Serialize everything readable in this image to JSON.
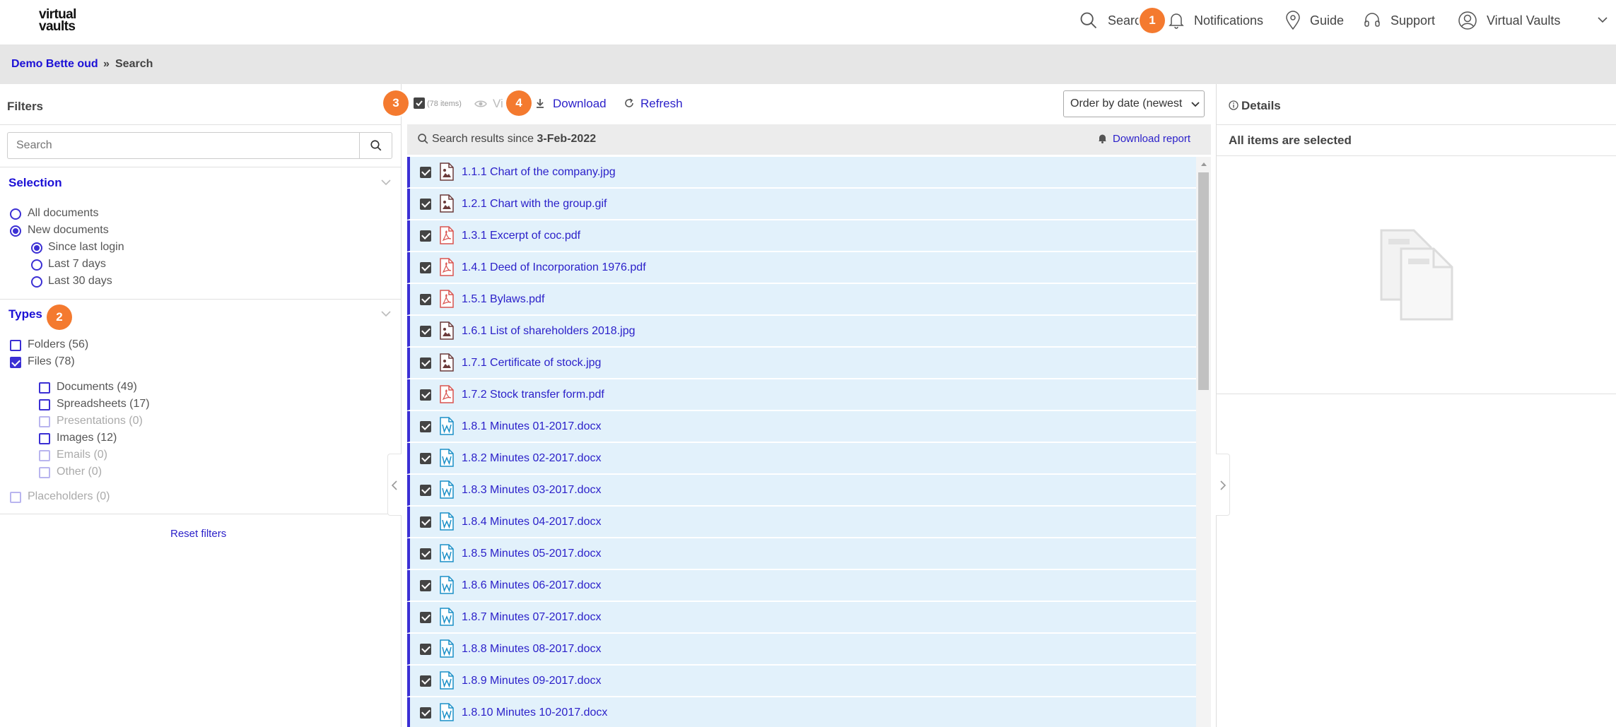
{
  "app": {
    "logo_line1": "virtual",
    "logo_line2": "vaults"
  },
  "topnav": {
    "search": "Searc",
    "notifications": "Notifications",
    "guide": "Guide",
    "support": "Support",
    "account": "Virtual Vaults"
  },
  "badges": {
    "b1": "1",
    "b2": "2",
    "b3": "3",
    "b4": "4"
  },
  "breadcrumb": {
    "root": "Demo Bette oud",
    "sep": "»",
    "current": "Search"
  },
  "filters": {
    "title": "Filters",
    "search_placeholder": "Search",
    "selection": {
      "title": "Selection",
      "all": "All documents",
      "new": "New documents",
      "since_login": "Since last login",
      "last7": "Last 7 days",
      "last30": "Last 30 days"
    },
    "types": {
      "title": "Types",
      "folders": "Folders (56)",
      "files": "Files (78)",
      "documents": "Documents (49)",
      "spreadsheets": "Spreadsheets (17)",
      "presentations": "Presentations (0)",
      "images": "Images (12)",
      "emails": "Emails (0)",
      "other": "Other (0)",
      "placeholders": "Placeholders (0)"
    },
    "reset": "Reset filters"
  },
  "toolbar": {
    "item_count": "(78 items)",
    "view": "Vi",
    "download": "Download",
    "refresh": "Refresh",
    "order": "Order by date (newest"
  },
  "results": {
    "prefix": "Search results since",
    "date": "3-Feb-2022",
    "download_report": "Download report",
    "items": [
      {
        "name": "1.1.1 Chart of the company.jpg",
        "type": "image"
      },
      {
        "name": "1.2.1 Chart with the group.gif",
        "type": "image"
      },
      {
        "name": "1.3.1 Excerpt of coc.pdf",
        "type": "pdf"
      },
      {
        "name": "1.4.1 Deed of Incorporation 1976.pdf",
        "type": "pdf"
      },
      {
        "name": "1.5.1 Bylaws.pdf",
        "type": "pdf"
      },
      {
        "name": "1.6.1 List of shareholders 2018.jpg",
        "type": "image"
      },
      {
        "name": "1.7.1 Certificate of stock.jpg",
        "type": "image"
      },
      {
        "name": "1.7.2 Stock transfer form.pdf",
        "type": "pdf"
      },
      {
        "name": "1.8.1 Minutes 01-2017.docx",
        "type": "word"
      },
      {
        "name": "1.8.2 Minutes 02-2017.docx",
        "type": "word"
      },
      {
        "name": "1.8.3 Minutes 03-2017.docx",
        "type": "word"
      },
      {
        "name": "1.8.4 Minutes 04-2017.docx",
        "type": "word"
      },
      {
        "name": "1.8.5 Minutes 05-2017.docx",
        "type": "word"
      },
      {
        "name": "1.8.6 Minutes 06-2017.docx",
        "type": "word"
      },
      {
        "name": "1.8.7 Minutes 07-2017.docx",
        "type": "word"
      },
      {
        "name": "1.8.8 Minutes 08-2017.docx",
        "type": "word"
      },
      {
        "name": "1.8.9 Minutes 09-2017.docx",
        "type": "word"
      },
      {
        "name": "1.8.10 Minutes 10-2017.docx",
        "type": "word"
      }
    ]
  },
  "details": {
    "title": "Details",
    "status": "All items are selected"
  },
  "colors": {
    "accent": "#3b2fd4",
    "badge": "#f47a2f",
    "row_bg": "#e2f1fb"
  }
}
